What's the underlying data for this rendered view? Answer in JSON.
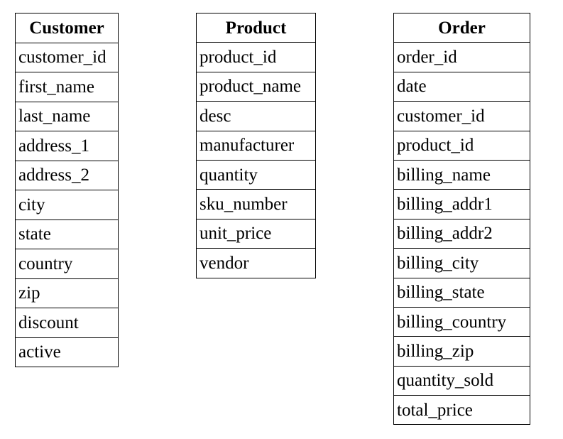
{
  "entities": {
    "customer": {
      "title": "Customer",
      "fields": [
        "customer_id",
        "first_name",
        "last_name",
        "address_1",
        "address_2",
        "city",
        "state",
        "country",
        "zip",
        "discount",
        "active"
      ]
    },
    "product": {
      "title": "Product",
      "fields": [
        "product_id",
        "product_name",
        "desc",
        "manufacturer",
        "quantity",
        "sku_number",
        "unit_price",
        "vendor"
      ]
    },
    "order": {
      "title": "Order",
      "fields": [
        "order_id",
        "date",
        "customer_id",
        "product_id",
        "billing_name",
        "billing_addr1",
        "billing_addr2",
        "billing_city",
        "billing_state",
        "billing_country",
        "billing_zip",
        "quantity_sold",
        "total_price"
      ]
    }
  }
}
